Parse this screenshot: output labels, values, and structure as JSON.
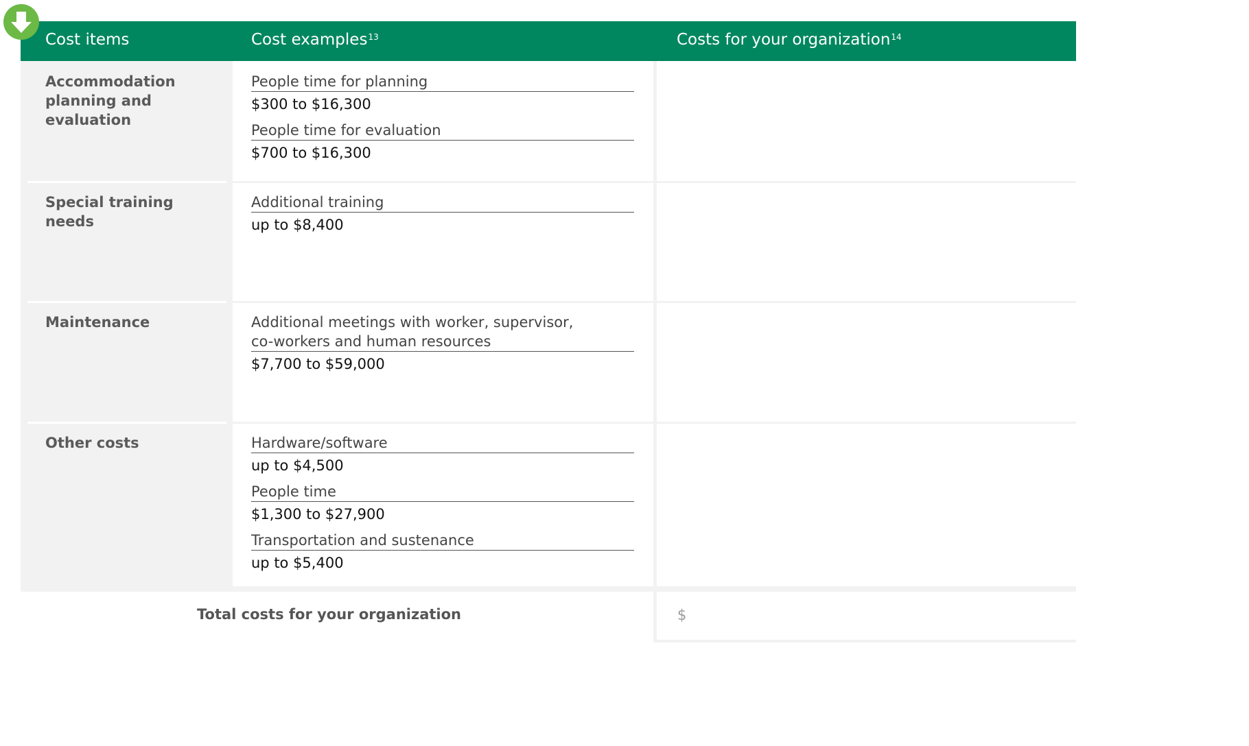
{
  "header": {
    "col1": "Cost items",
    "col2": "Cost examples",
    "col2_footnote": "13",
    "col3": "Costs for your organization",
    "col3_footnote": "14"
  },
  "rows": [
    {
      "item": "Accommodation planning and evaluation",
      "examples": [
        {
          "label": "People time for planning",
          "value": "$300 to $16,300"
        },
        {
          "label": "People time for evaluation",
          "value": "$700 to $16,300"
        }
      ]
    },
    {
      "item": "Special training needs",
      "examples": [
        {
          "label": "Additional training",
          "value": "up to $8,400"
        }
      ]
    },
    {
      "item": "Maintenance",
      "examples": [
        {
          "label": "Additional meetings with worker, supervisor, co-workers and human resources",
          "value": "$7,700 to $59,000"
        }
      ]
    },
    {
      "item": "Other costs",
      "examples": [
        {
          "label": "Hardware/software",
          "value": "up to $4,500"
        },
        {
          "label": "People time",
          "value": "$1,300 to $27,900"
        },
        {
          "label": "Transportation and sustenance",
          "value": "up to $5,400"
        }
      ]
    }
  ],
  "total": {
    "label": "Total costs for your organization",
    "currency_symbol": "$"
  },
  "colors": {
    "header_green": "#00875f",
    "badge_green": "#6cb946",
    "panel_gray": "#f2f2f2"
  },
  "icons": {
    "badge": "download-arrow-icon"
  }
}
